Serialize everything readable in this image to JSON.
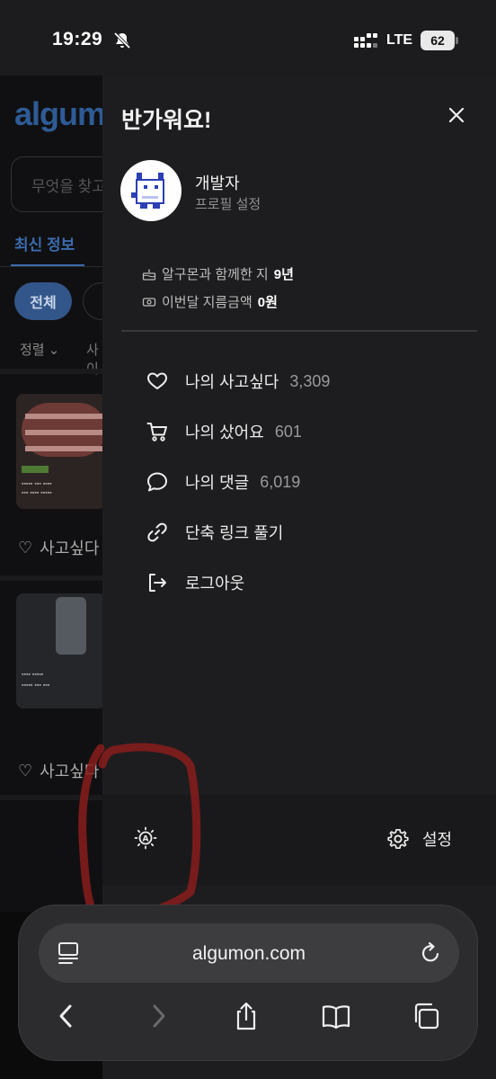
{
  "status_bar": {
    "time": "19:29",
    "network": "LTE",
    "battery": "62"
  },
  "background_page": {
    "logo": "algum",
    "search_placeholder": "무엇을 찾고",
    "tab_latest": "최신 정보",
    "chip_all": "전체",
    "sort_label": "정렬",
    "sort_label2": "사이",
    "like_label_1": "사고싶다",
    "like_label_2": "사고싶다"
  },
  "drawer": {
    "title": "반가워요!",
    "user": {
      "name": "개발자",
      "profile_link": "프로필 설정"
    },
    "stats": [
      {
        "label": "알구몬과 함께한 지",
        "value": "9년",
        "icon": "cake-icon"
      },
      {
        "label": "이번달 지름금액",
        "value": "0원",
        "icon": "money-icon"
      }
    ],
    "menu": [
      {
        "label": "나의 사고싶다",
        "count": "3,309",
        "icon": "heart-icon"
      },
      {
        "label": "나의 샀어요",
        "count": "601",
        "icon": "cart-icon"
      },
      {
        "label": "나의 댓글",
        "count": "6,019",
        "icon": "comment-icon"
      },
      {
        "label": "단축 링크 풀기",
        "count": "",
        "icon": "link-icon"
      },
      {
        "label": "로그아웃",
        "count": "",
        "icon": "logout-icon"
      }
    ],
    "settings_label": "설정"
  },
  "browser": {
    "url": "algumon.com"
  },
  "colors": {
    "accent": "#3c6cae",
    "drawer_bg": "#1d1d1f",
    "annotation": "#8a1c1c"
  }
}
